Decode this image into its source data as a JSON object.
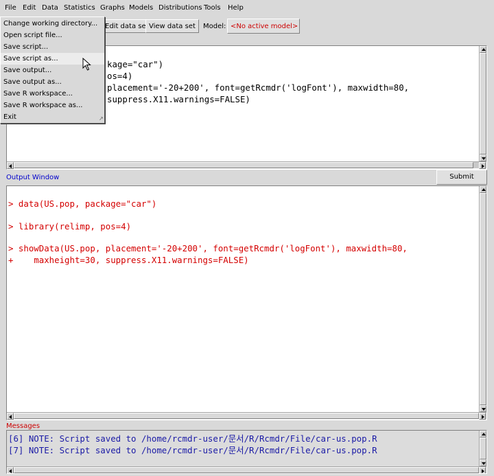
{
  "menubar": {
    "items": [
      "File",
      "Edit",
      "Data",
      "Statistics",
      "Graphs",
      "Models",
      "Distributions",
      "Tools",
      "Help"
    ]
  },
  "toolbar": {
    "edit_data_set": "Edit data set",
    "view_data_set": "View data set",
    "model_label": "Model:",
    "model_value": "<No active model>"
  },
  "script_window": {
    "lines": [
      "kage=\"car\")",
      "os=4)",
      "placement='-20+200', font=getRcmdr('logFont'), maxwidth=80,",
      "suppress.X11.warnings=FALSE)"
    ]
  },
  "output_window": {
    "label": "Output Window",
    "submit": "Submit",
    "lines": [
      "> data(US.pop, package=\"car\")",
      "",
      "> library(relimp, pos=4)",
      "",
      "> showData(US.pop, placement='-20+200', font=getRcmdr('logFont'), maxwidth=80,",
      "+    maxheight=30, suppress.X11.warnings=FALSE)"
    ]
  },
  "messages": {
    "label": "Messages",
    "lines": [
      "[6] NOTE: Script saved to /home/rcmdr-user/문서/R/Rcmdr/File/car-us.pop.R",
      "[7] NOTE: Script saved to /home/rcmdr-user/문서/R/Rcmdr/File/car-us.pop.R"
    ]
  },
  "file_menu": {
    "items": [
      "Change working directory...",
      "Open script file...",
      "Save script...",
      "Save script as...",
      "Save output...",
      "Save output as...",
      "Save R workspace...",
      "Save R workspace as...",
      "Exit"
    ],
    "highlighted": "Save script as..."
  },
  "colors": {
    "output_text": "#d40000",
    "messages_text": "#1a1aa6",
    "label_blue": "#0000cc",
    "label_red": "#cc0000",
    "model_red": "#cc0000"
  }
}
